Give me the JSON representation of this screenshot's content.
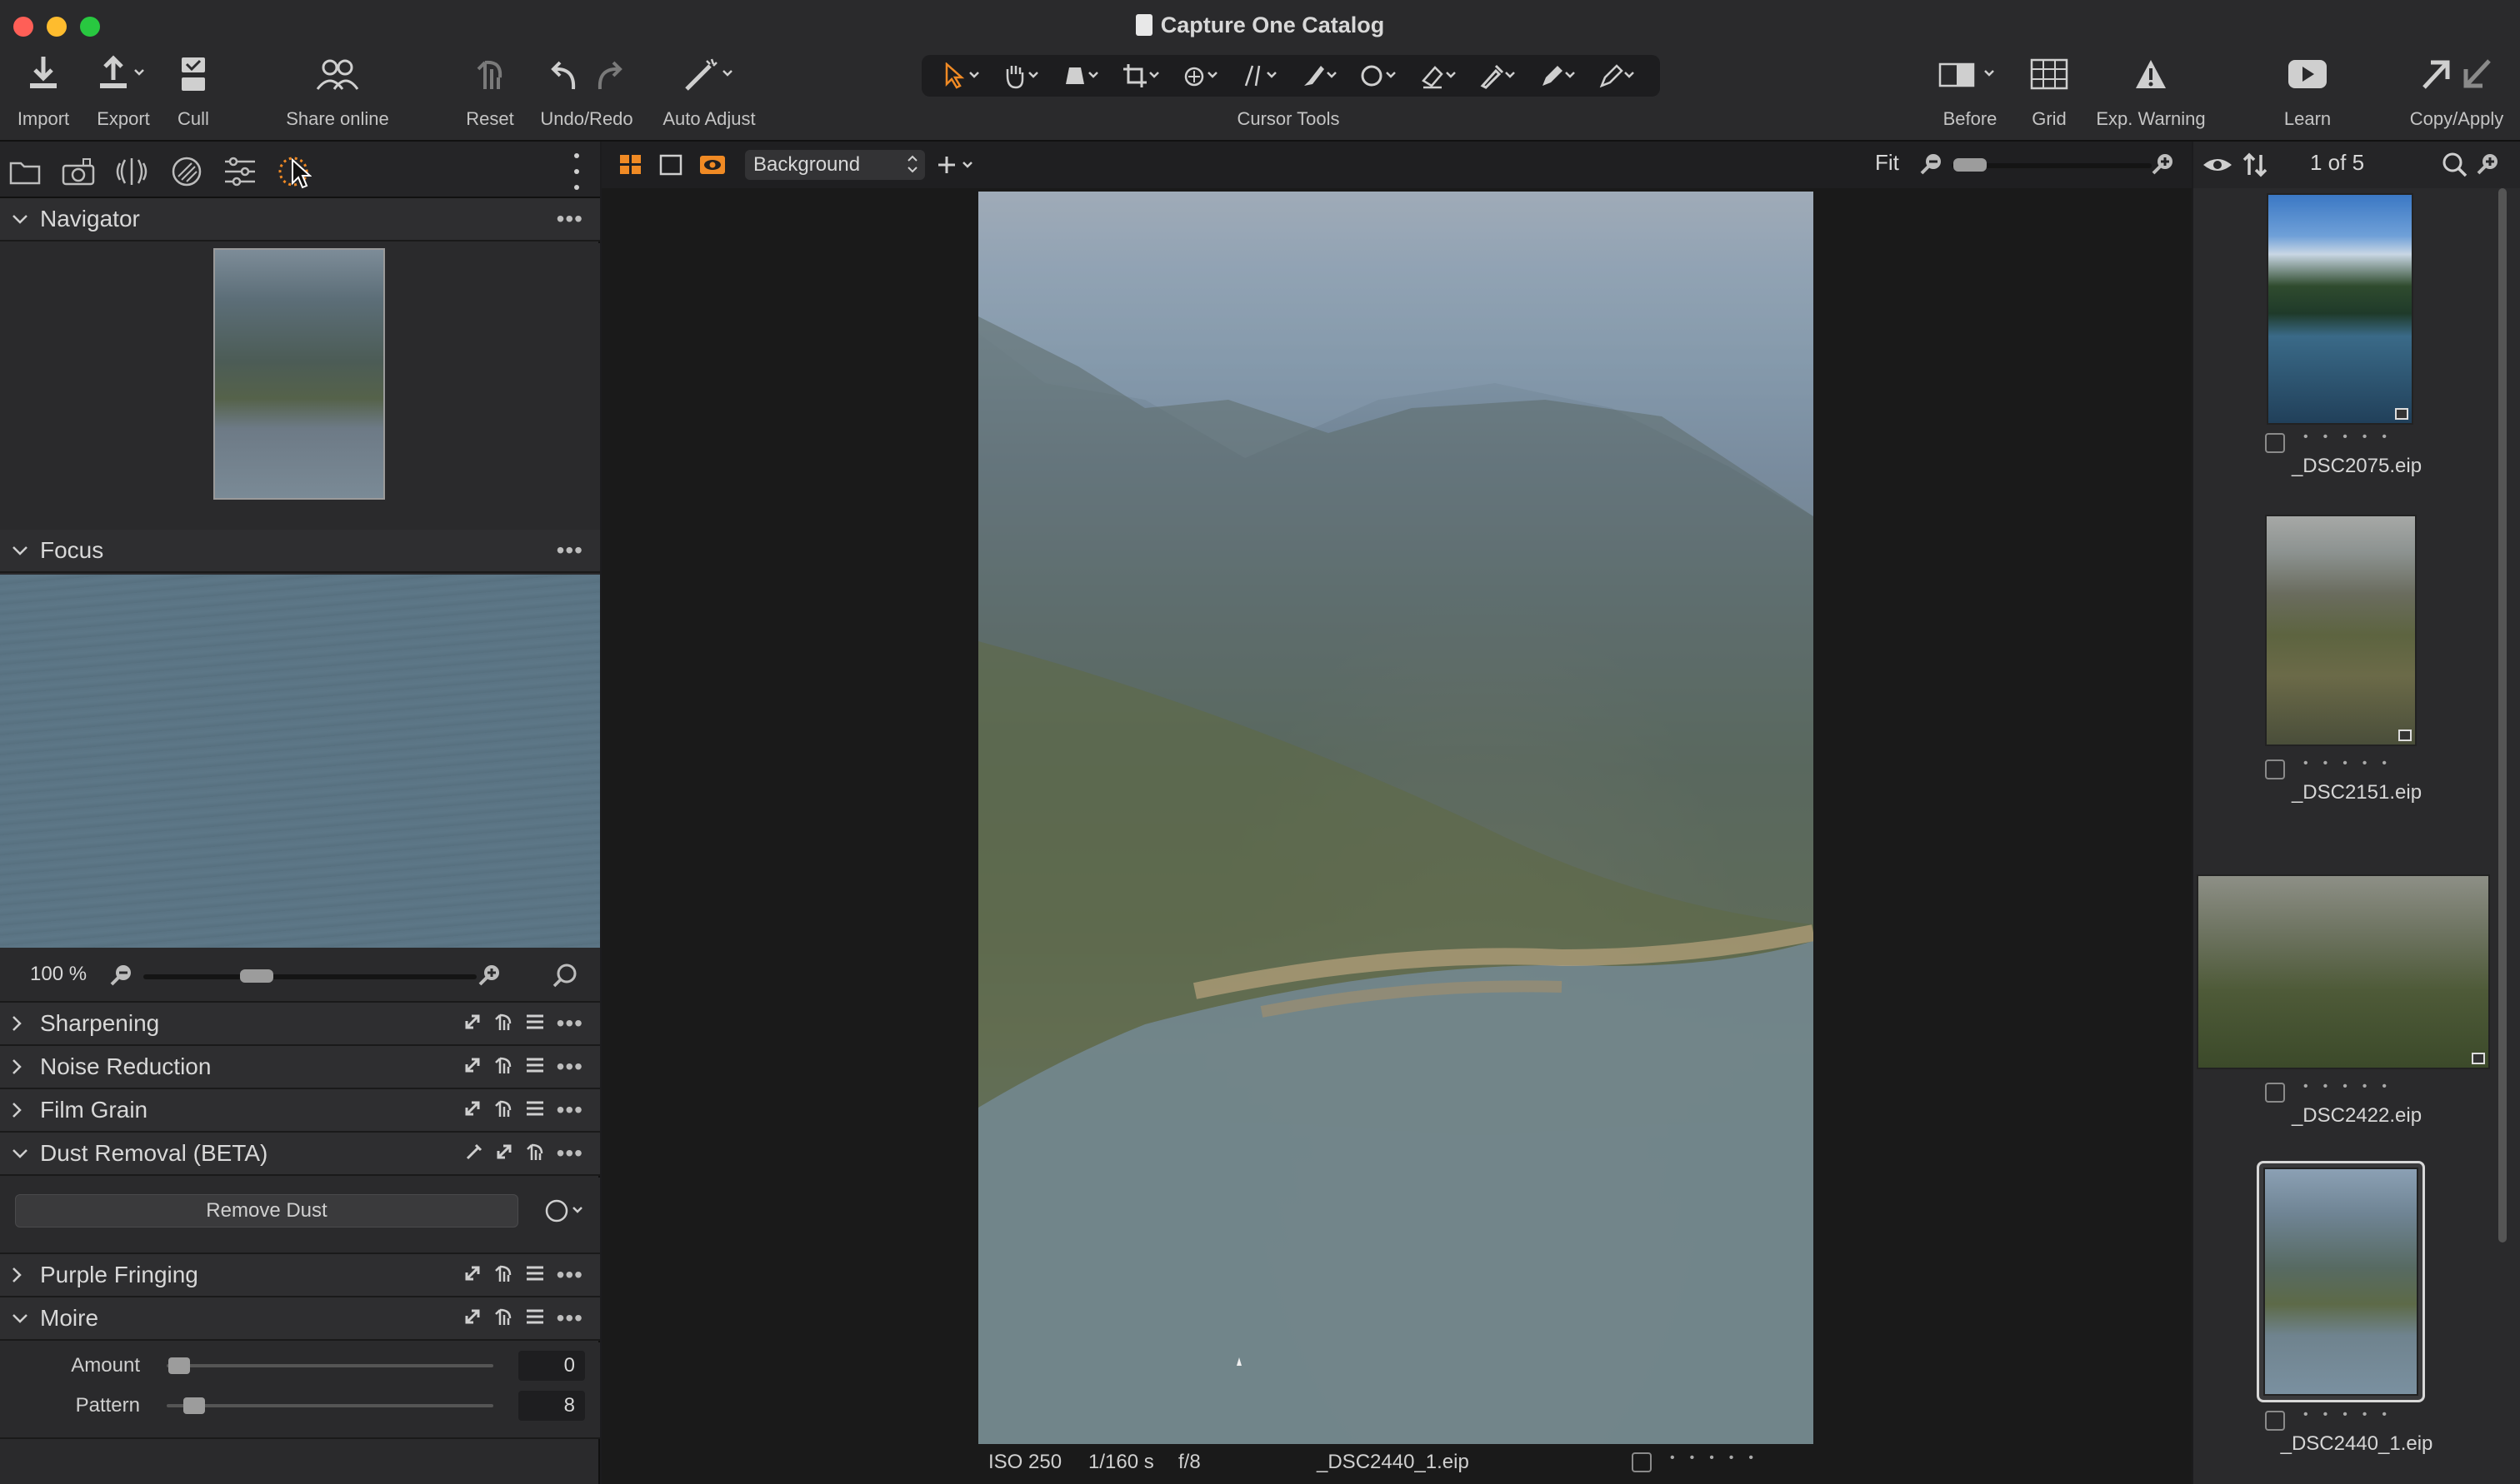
{
  "window": {
    "title": "Capture One Catalog"
  },
  "toolbar": {
    "import": "Import",
    "export": "Export",
    "cull": "Cull",
    "share_online": "Share online",
    "reset": "Reset",
    "undo_redo": "Undo/Redo",
    "auto_adjust": "Auto Adjust",
    "cursor_tools": "Cursor Tools",
    "before": "Before",
    "grid": "Grid",
    "exp_warning": "Exp. Warning",
    "learn": "Learn",
    "copy_apply": "Copy/Apply"
  },
  "left_panel": {
    "navigator": {
      "title": "Navigator"
    },
    "focus": {
      "title": "Focus",
      "zoom": "100 %"
    },
    "sections": {
      "sharpening": "Sharpening",
      "noise_reduction": "Noise Reduction",
      "film_grain": "Film Grain",
      "dust_removal": "Dust Removal (BETA)",
      "remove_dust_button": "Remove Dust",
      "purple_fringing": "Purple Fringing",
      "moire": "Moire"
    },
    "moire": {
      "amount_label": "Amount",
      "amount_value": "0",
      "pattern_label": "Pattern",
      "pattern_value": "8"
    }
  },
  "viewer": {
    "layer": "Background",
    "fit": "Fit",
    "status": {
      "iso": "ISO 250",
      "shutter": "1/160 s",
      "aperture": "f/8",
      "filename": "_DSC2440_1.eip"
    }
  },
  "browser": {
    "counter": "1 of 5",
    "items": [
      {
        "name": "_DSC2075.eip"
      },
      {
        "name": "_DSC2151.eip"
      },
      {
        "name": "_DSC2422.eip"
      },
      {
        "name": "_DSC2440_1.eip"
      }
    ]
  },
  "colors": {
    "accent_orange": "#f08a24",
    "traffic_red": "#ff5f57",
    "traffic_yellow": "#febc2e",
    "traffic_green": "#28c840"
  }
}
